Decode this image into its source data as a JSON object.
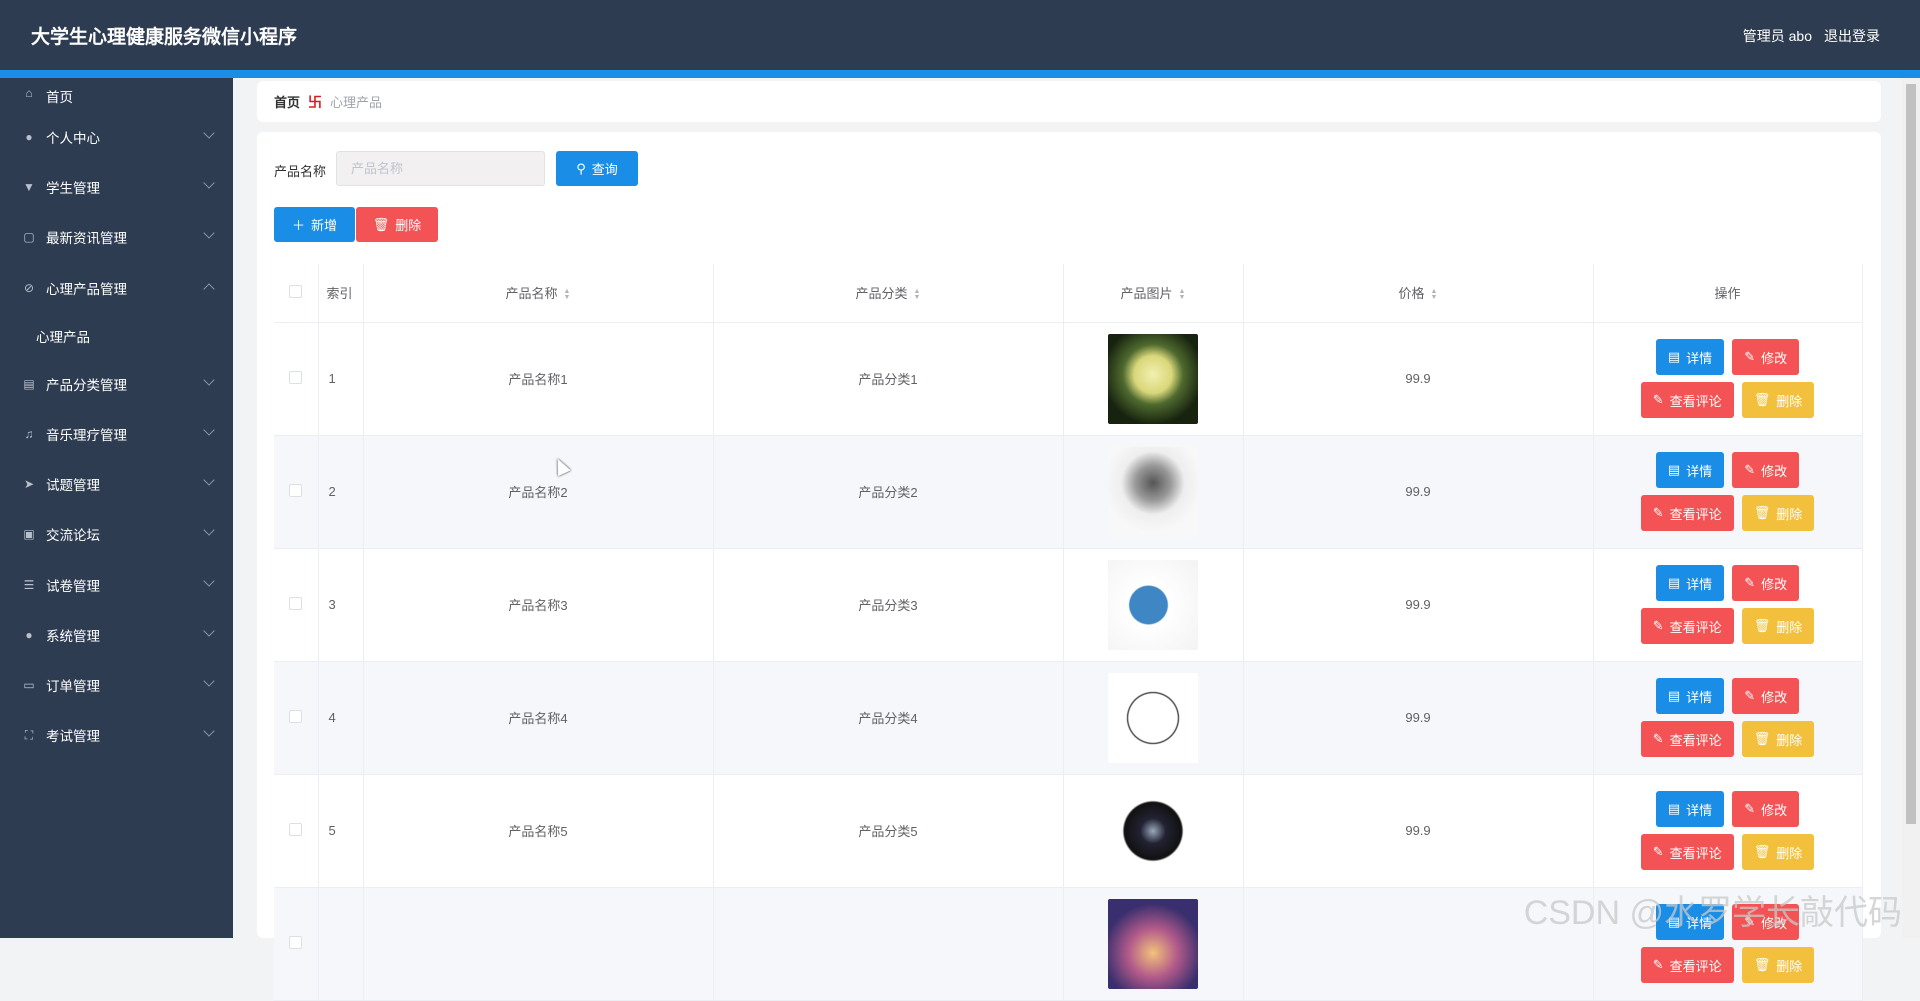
{
  "header": {
    "title": "大学生心理健康服务微信小程序",
    "user": "管理员 abo",
    "logout": "退出登录"
  },
  "sidebar": [
    {
      "label": "首页",
      "icon": "home-icon",
      "chev": ""
    },
    {
      "label": "个人中心",
      "icon": "user-icon",
      "chev": "down"
    },
    {
      "label": "学生管理",
      "icon": "student-icon",
      "chev": "down"
    },
    {
      "label": "最新资讯管理",
      "icon": "copy-icon",
      "chev": "down"
    },
    {
      "label": "心理产品管理",
      "icon": "bell-off-icon",
      "chev": "up"
    },
    {
      "label": "心理产品",
      "icon": "",
      "chev": "",
      "sub": true
    },
    {
      "label": "产品分类管理",
      "icon": "clipboard-icon",
      "chev": "down"
    },
    {
      "label": "音乐理疗管理",
      "icon": "music-icon",
      "chev": "down"
    },
    {
      "label": "试题管理",
      "icon": "send-icon",
      "chev": "down"
    },
    {
      "label": "交流论坛",
      "icon": "forum-icon",
      "chev": "down"
    },
    {
      "label": "试卷管理",
      "icon": "sliders-icon",
      "chev": "down"
    },
    {
      "label": "系统管理",
      "icon": "system-icon",
      "chev": "down"
    },
    {
      "label": "订单管理",
      "icon": "order-icon",
      "chev": "down"
    },
    {
      "label": "考试管理",
      "icon": "fullscreen-icon",
      "chev": "down"
    }
  ],
  "breadcrumb": {
    "home": "首页",
    "current": "心理产品"
  },
  "search": {
    "label": "产品名称",
    "placeholder": "产品名称",
    "value": "",
    "query": "查询"
  },
  "actions": {
    "add": "新增",
    "delete": "删除"
  },
  "table": {
    "headers": [
      "索引",
      "产品名称",
      "产品分类",
      "产品图片",
      "价格",
      "操作"
    ],
    "rows": [
      {
        "index": "1",
        "name": "产品名称1",
        "category": "产品分类1",
        "price": "99.9",
        "image": "moon-silhouette"
      },
      {
        "index": "2",
        "name": "产品名称2",
        "category": "产品分类2",
        "price": "99.9",
        "image": "tree"
      },
      {
        "index": "3",
        "name": "产品名称3",
        "category": "产品分类3",
        "price": "99.9",
        "image": "radar-chart"
      },
      {
        "index": "4",
        "name": "产品名称4",
        "category": "产品分类4",
        "price": "99.9",
        "image": "test-analysis"
      },
      {
        "index": "5",
        "name": "产品名称5",
        "category": "产品分类5",
        "price": "99.9",
        "image": "tarot-cloth"
      },
      {
        "index": "",
        "name": "",
        "category": "",
        "price": "",
        "image": "mandala"
      }
    ],
    "ops": {
      "detail": "详情",
      "edit": "修改",
      "comments": "查看评论",
      "delete": "删除"
    }
  },
  "watermark": "CSDN @水罗学长敲代码"
}
